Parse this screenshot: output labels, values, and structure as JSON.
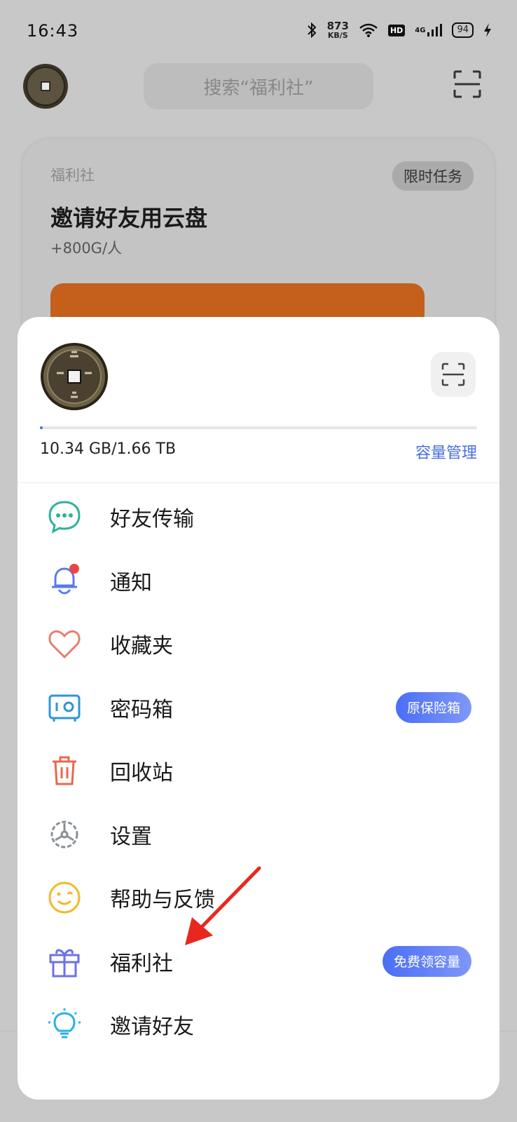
{
  "status_bar": {
    "time": "16:43",
    "net_speed_value": "873",
    "net_speed_unit": "KB/S",
    "hd_label": "HD",
    "network_label": "4G",
    "battery": "94"
  },
  "header": {
    "search_placeholder": "搜索“福利社”"
  },
  "promo_card": {
    "section": "福利社",
    "tag": "限时任务",
    "title": "邀请好友用云盘",
    "bonus": "+800G/人"
  },
  "account": {
    "storage_text": "10.34 GB/1.66 TB",
    "usage_fraction": 0.006,
    "manage_label": "容量管理"
  },
  "menu": [
    {
      "label": "好友传输",
      "icon": "chat-icon"
    },
    {
      "label": "通知",
      "icon": "bell-icon"
    },
    {
      "label": "收藏夹",
      "icon": "heart-icon"
    },
    {
      "label": "密码箱",
      "icon": "safe-icon",
      "badge": "原保险箱"
    },
    {
      "label": "回收站",
      "icon": "trash-icon"
    },
    {
      "label": "设置",
      "icon": "gear-icon"
    },
    {
      "label": "帮助与反馈",
      "icon": "smiley-icon"
    },
    {
      "label": "福利社",
      "icon": "gift-icon",
      "badge": "免费领容量"
    },
    {
      "label": "邀请好友",
      "icon": "lightbulb-icon"
    }
  ],
  "colors": {
    "accent": "#4a6ee0",
    "overlay": "#c8c8c8",
    "promo_banner": "#c4601c",
    "annotation_arrow": "#e8281e"
  }
}
